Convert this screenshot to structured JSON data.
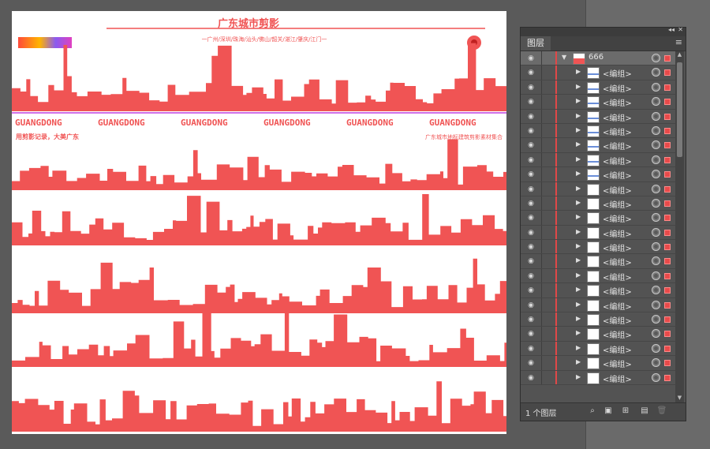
{
  "artwork": {
    "title_cn": "广东城市剪影",
    "subtitle_cn": "一广州/深圳/珠海/汕头/佛山/韶关/湛江/肇庆/江门一",
    "band_text": "GUANGDONG",
    "band_repeat": 6,
    "caption_left": "用剪影记录，大美广东",
    "caption_right": "广东城市地标建筑剪影素材集合",
    "silhouette_color": "#f05454",
    "accent_color": "#c040e0"
  },
  "layers_panel": {
    "tab_label": "图层",
    "menu_icon": "panel-menu-icon",
    "layer_name": "666",
    "group_label": "<编组>",
    "group_count": 22,
    "footer_count": "1 个图层",
    "footer_icons": [
      "search-icon",
      "clip-mask-icon",
      "sublayer-icon",
      "new-layer-icon",
      "delete-icon"
    ],
    "selection_color": "#e84a4a"
  }
}
